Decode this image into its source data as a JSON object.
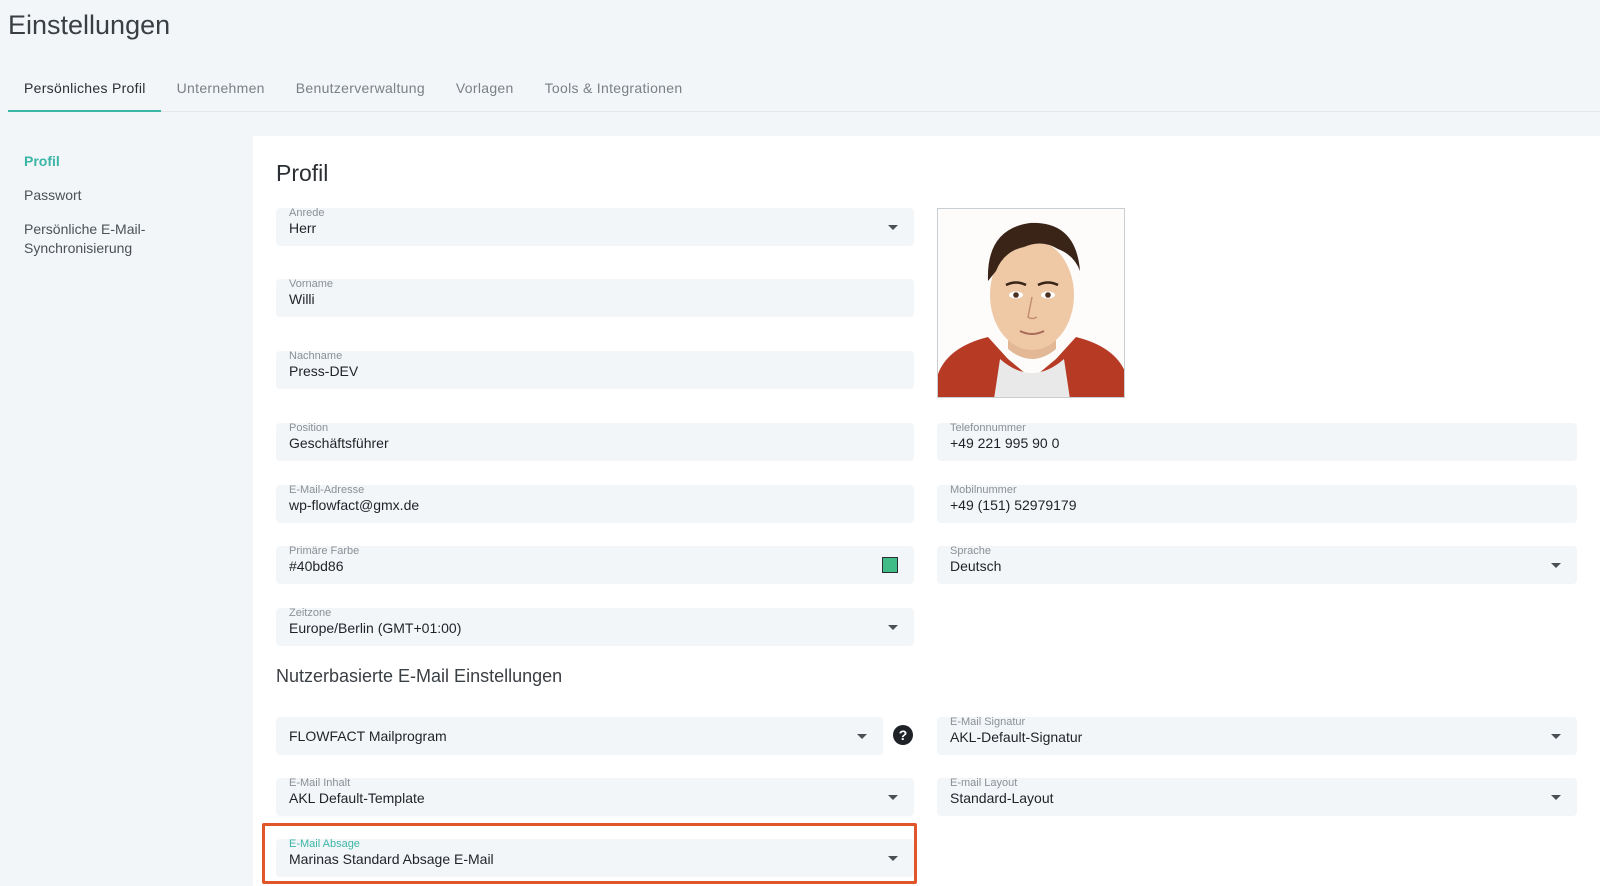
{
  "page": {
    "title": "Einstellungen"
  },
  "tabs": [
    {
      "label": "Persönliches Profil",
      "active": true
    },
    {
      "label": "Unternehmen"
    },
    {
      "label": "Benutzerverwaltung"
    },
    {
      "label": "Vorlagen"
    },
    {
      "label": "Tools & Integrationen"
    }
  ],
  "subnav": [
    {
      "label": "Profil",
      "active": true
    },
    {
      "label": "Passwort"
    },
    {
      "label": "Persönliche E-Mail-Synchronisierung"
    }
  ],
  "profile": {
    "title": "Profil",
    "fields": {
      "anrede": {
        "label": "Anrede",
        "value": "Herr"
      },
      "vorname": {
        "label": "Vorname",
        "value": "Willi"
      },
      "nachname": {
        "label": "Nachname",
        "value": "Press-DEV"
      },
      "position": {
        "label": "Position",
        "value": "Geschäftsführer"
      },
      "email": {
        "label": "E-Mail-Adresse",
        "value": "wp-flowfact@gmx.de"
      },
      "farbe": {
        "label": "Primäre Farbe",
        "value": "#40bd86"
      },
      "zeitzone": {
        "label": "Zeitzone",
        "value": "Europe/Berlin (GMT+01:00)"
      },
      "telefon": {
        "label": "Telefonnummer",
        "value": "+49 221 995 90 0"
      },
      "mobil": {
        "label": "Mobilnummer",
        "value": "+49 (151) 52979179"
      },
      "sprache": {
        "label": "Sprache",
        "value": "Deutsch"
      }
    }
  },
  "email_settings": {
    "title": "Nutzerbasierte E-Mail Einstellungen",
    "mailprogram": {
      "value": "FLOWFACT Mailprogram"
    },
    "signatur": {
      "label": "E-Mail Signatur",
      "value": "AKL-Default-Signatur"
    },
    "inhalt": {
      "label": "E-Mail Inhalt",
      "value": "AKL Default-Template"
    },
    "layout": {
      "label": "E-mail Layout",
      "value": "Standard-Layout"
    },
    "absage": {
      "label": "E-Mail Absage",
      "value": "Marinas Standard Absage E-Mail"
    }
  },
  "icons": {
    "help": "question-circle-icon",
    "caret": "caret-down-icon"
  },
  "colors": {
    "accent": "#3bb6a6",
    "highlight": "#e0552a",
    "primary_swatch": "#40bd86"
  }
}
